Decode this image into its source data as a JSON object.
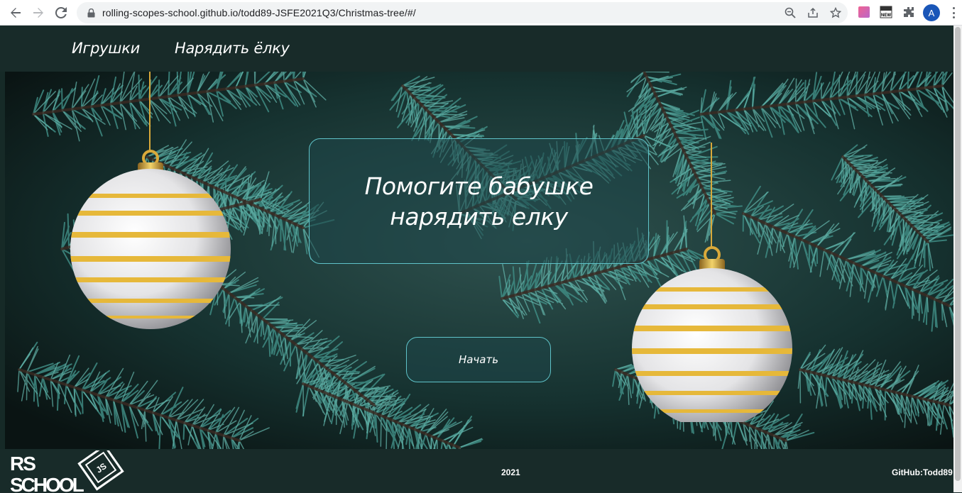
{
  "browser": {
    "url": "rolling-scopes-school.github.io/todd89-JSFE2021Q3/Christmas-tree/#/",
    "avatar_letter": "A",
    "extension_badge": "NEW"
  },
  "nav": {
    "toys": "Игрушки",
    "decorate_tree": "Нарядить ёлку"
  },
  "hero": {
    "title": "Помогите бабушке нарядить елку",
    "start_label": "Начать"
  },
  "footer": {
    "year": "2021",
    "github": "GitHub:Todd89",
    "logo_text_top": "RS",
    "logo_text_bottom": "SCHOOL",
    "logo_badge": "JS"
  },
  "colors": {
    "header_bg": "#182b29",
    "panel_border": "#5fc3c9",
    "ornament_stripe": "#e6b83a"
  }
}
